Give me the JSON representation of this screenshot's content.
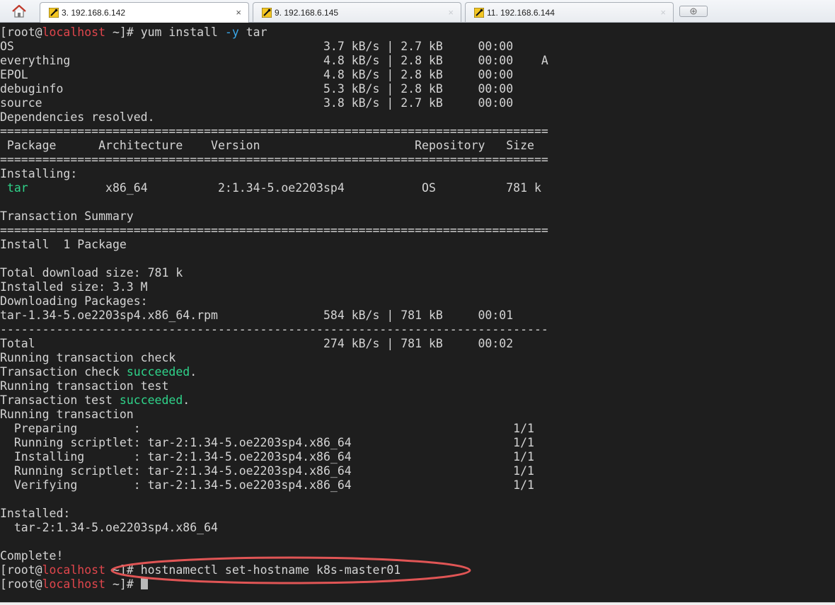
{
  "tabs": [
    {
      "label": "3. 192.168.6.142",
      "active": true
    },
    {
      "label": "9. 192.168.6.145",
      "active": false
    },
    {
      "label": "11. 192.168.6.144",
      "active": false
    }
  ],
  "tab_close_glyph": "×",
  "icons": {
    "home": "home-icon",
    "tab": "session-icon",
    "new_tab": "new-tab-icon",
    "close": "close-icon"
  },
  "colors": {
    "terminal_bg": "#1e1e1e",
    "prompt_host": "#e0464c",
    "option_flag": "#3aa6e8",
    "success_text": "#2fd38a",
    "annotation": "#e05555"
  },
  "terminal": {
    "prompt": {
      "user": "[root@",
      "host": "localhost",
      "dir": " ~]# "
    },
    "command1_pre": "yum install ",
    "command1_flag": "-y",
    "command1_post": " tar",
    "repo_lines": [
      "OS                                            3.7 kB/s | 2.7 kB     00:00",
      "everything                                    4.8 kB/s | 2.8 kB     00:00    A",
      "EPOL                                          4.8 kB/s | 2.8 kB     00:00",
      "debuginfo                                     5.3 kB/s | 2.8 kB     00:00",
      "source                                        3.8 kB/s | 2.7 kB     00:00"
    ],
    "deps_resolved": "Dependencies resolved.",
    "separator_double": "==============================================================================",
    "header_line": " Package      Architecture    Version                      Repository   Size",
    "installing_label": "Installing:",
    "pkg_name": "tar",
    "pkg_rest": "           x86_64          2:1.34-5.oe2203sp4           OS          781 k",
    "blank": "",
    "transaction_summary": "Transaction Summary",
    "install_count": "Install  1 Package",
    "total_download": "Total download size: 781 k",
    "installed_size": "Installed size: 3.3 M",
    "downloading": "Downloading Packages:",
    "rpm_line": "tar-1.34-5.oe2203sp4.x86_64.rpm               584 kB/s | 781 kB     00:01",
    "separator_dash": "------------------------------------------------------------------------------",
    "total_line": "Total                                         274 kB/s | 781 kB     00:02",
    "running_check": "Running transaction check",
    "check_pre": "Transaction check ",
    "succeeded": "succeeded",
    "period": ".",
    "running_test": "Running transaction test",
    "test_pre": "Transaction test ",
    "running_transaction": "Running transaction",
    "steps": [
      "  Preparing        :                                                     1/1",
      "  Running scriptlet: tar-2:1.34-5.oe2203sp4.x86_64                       1/1",
      "  Installing       : tar-2:1.34-5.oe2203sp4.x86_64                       1/1",
      "  Running scriptlet: tar-2:1.34-5.oe2203sp4.x86_64                       1/1",
      "  Verifying        : tar-2:1.34-5.oe2203sp4.x86_64                       1/1"
    ],
    "installed_label": "Installed:",
    "installed_pkg": "  tar-2:1.34-5.oe2203sp4.x86_64",
    "complete": "Complete!",
    "command2": "hostnamectl set-hostname k8s-master01"
  }
}
